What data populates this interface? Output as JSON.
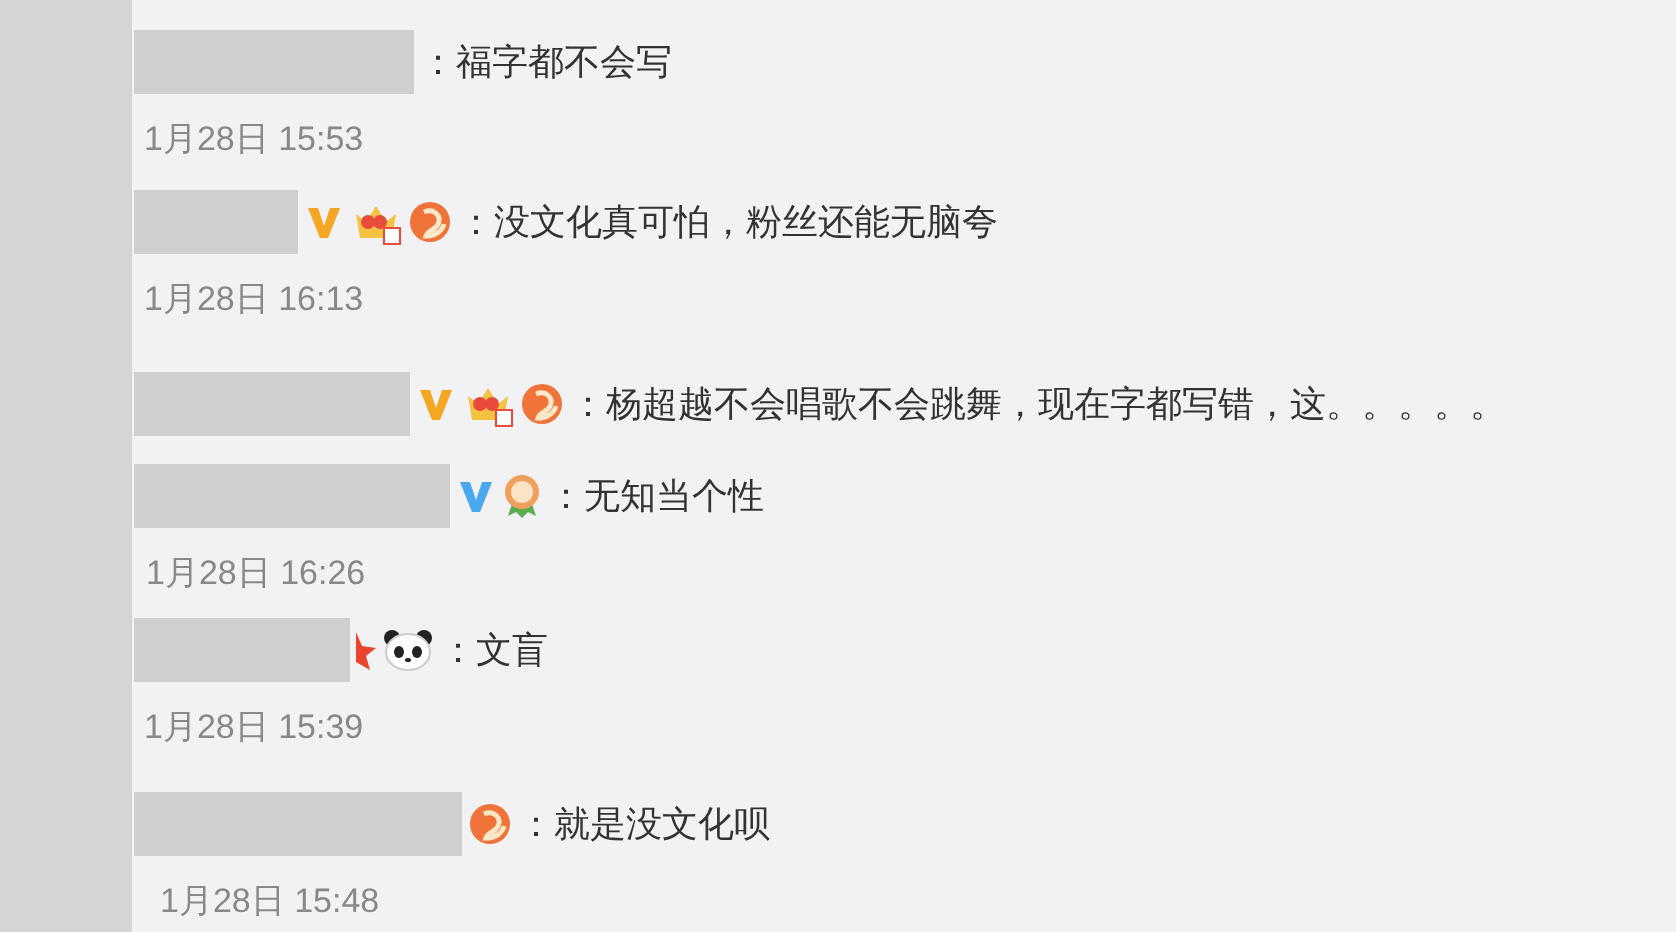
{
  "comments": [
    {
      "text": "：福字都不会写",
      "time": "1月28日 15:53"
    },
    {
      "badges": [
        {
          "kind": "v",
          "color": "#f5a623"
        },
        {
          "kind": "crown"
        },
        {
          "kind": "shrimp"
        }
      ],
      "text": "：没文化真可怕，粉丝还能无脑夸",
      "time": "1月28日 16:13"
    },
    {
      "badges": [
        {
          "kind": "v",
          "color": "#f5a623"
        },
        {
          "kind": "crown"
        },
        {
          "kind": "shrimp"
        }
      ],
      "text": "：杨超越不会唱歌不会跳舞，现在字都写错，这。。。。。"
    },
    {
      "badges": [
        {
          "kind": "v",
          "color": "#4aa8ef"
        },
        {
          "kind": "medal"
        }
      ],
      "text": "：无知当个性",
      "time": "1月28日 16:26"
    },
    {
      "badges": [
        {
          "kind": "star"
        },
        {
          "kind": "panda"
        }
      ],
      "text": "：文盲",
      "time": "1月28日 15:39"
    },
    {
      "badges": [
        {
          "kind": "shrimp"
        }
      ],
      "text": "：就是没文化呗",
      "time": "1月28日 15:48"
    }
  ]
}
